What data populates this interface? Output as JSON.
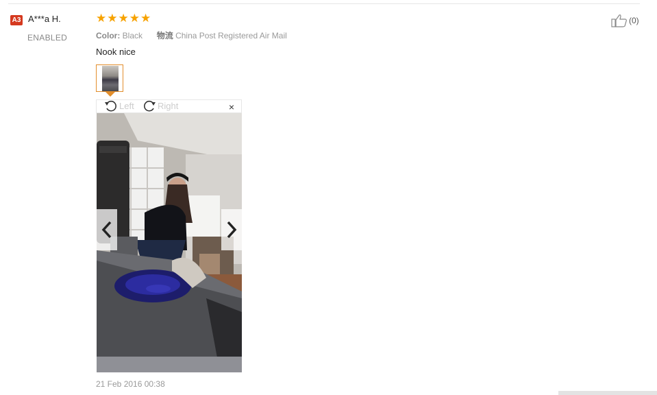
{
  "reviewer": {
    "badge": "A3",
    "name": "A***a H.",
    "status": "ENABLED"
  },
  "rating": {
    "stars": 5,
    "max": 5
  },
  "meta": {
    "color_label": "Color:",
    "color_value": "Black",
    "shipping_label": "物流",
    "shipping_value": "China Post Registered Air Mail"
  },
  "review_text": "Nook nice",
  "viewer": {
    "rotate_left_label": "Left",
    "rotate_right_label": "Right",
    "close_symbol": "×"
  },
  "date": "21 Feb 2016 00:38",
  "helpful": {
    "count": "(0)"
  },
  "colors": {
    "star": "#f7a200",
    "badge": "#d5391f",
    "thumb_border": "#e28d2b"
  }
}
